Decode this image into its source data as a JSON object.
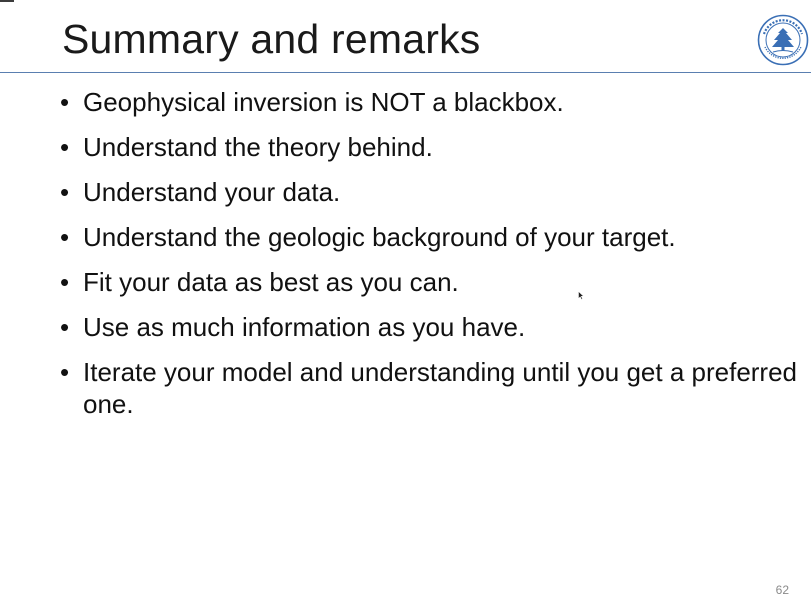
{
  "slide": {
    "title": "Summary and remarks",
    "bullets": [
      "Geophysical inversion is NOT a blackbox.",
      "Understand the theory behind.",
      "Understand your data.",
      "Understand the geologic background of your target.",
      "Fit your data as best as you can.",
      "Use as much information as you have.",
      "Iterate your model and understanding until you get a preferred one."
    ],
    "page_number": "62",
    "bullet_glyph": "•"
  },
  "colors": {
    "title_rule": "#5a7fb0",
    "logo_blue": "#3a6fb5",
    "text": "#111111",
    "page_number": "#8a8a8a"
  },
  "icons": {
    "logo": "university-seal-icon",
    "cursor": "mouse-cursor-icon"
  }
}
